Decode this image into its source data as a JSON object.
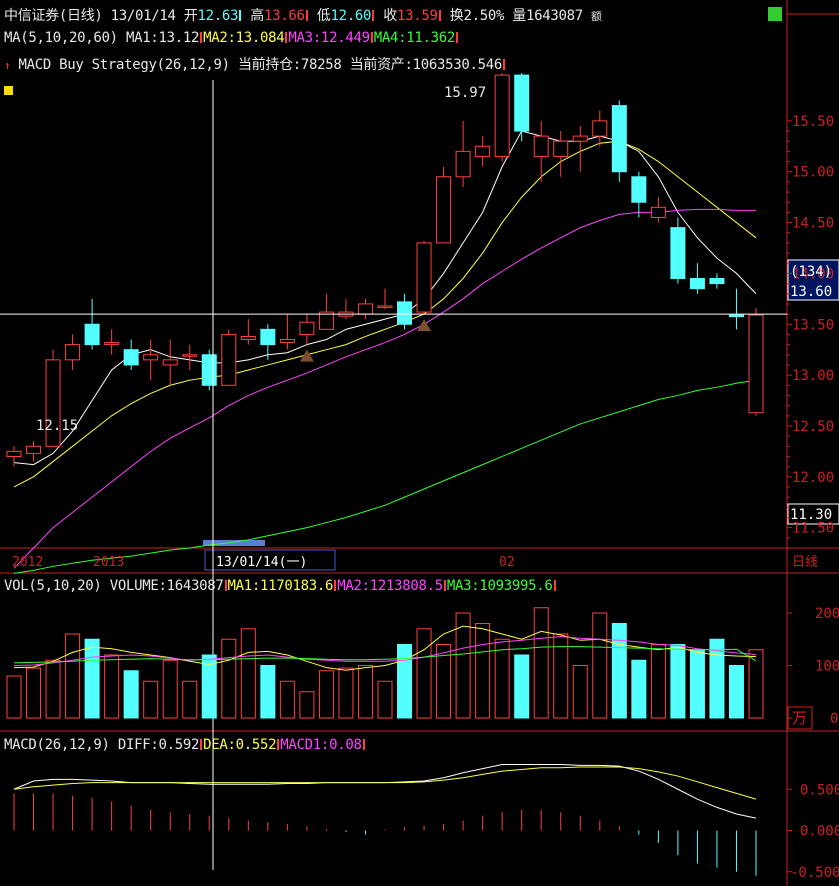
{
  "header": {
    "name": "中信证券",
    "period": "(日线)",
    "date": "13/01/14",
    "open_label": "开",
    "open": "12.63",
    "high_label": "高",
    "high": "13.66",
    "low_label": "低",
    "low": "12.60",
    "close_label": "收",
    "close": "13.59",
    "turnover_label": "换",
    "turnover": "2.50%",
    "volume_label": "量",
    "volume": "1643087",
    "extra": "额"
  },
  "ma_line": {
    "params": "MA(5,10,20,60)",
    "ma1": "MA1:13.12",
    "ma2": "MA2:13.084",
    "ma3": "MA3:12.449",
    "ma4": "MA4:11.362"
  },
  "strategy_line": {
    "name": "MACD Buy Strategy(26,12,9)",
    "position": "当前持仓:78258",
    "assets": "当前资产:1063530.546"
  },
  "vol_line": {
    "params": "VOL(5,10,20)",
    "volume": "VOLUME:1643087",
    "ma1": "MA1:1170183.6",
    "ma2": "MA2:1213808.5",
    "ma3": "MA3:1093995.6"
  },
  "macd_line": {
    "params": "MACD(26,12,9)",
    "diff": "DIFF:0.592",
    "dea": "DEA:0.552",
    "macd": "MACD1:0.08"
  },
  "labels": {
    "peak": "15.97",
    "trough": "12.15",
    "cursor_date": "13/01/14(一)",
    "year1": "2012",
    "year2": "2013",
    "month": "02",
    "period_btn": "日线",
    "unit": "万",
    "cursor_count": "(134)",
    "cursor_price": "13.60",
    "last_price": "11.30"
  },
  "chart_data": [
    {
      "type": "candlestick",
      "title": "中信证券(日线)",
      "ylim": [
        11.3,
        16.0
      ],
      "y_ticks": [
        "15.50",
        "15.00",
        "14.50",
        "14.00",
        "13.50",
        "13.00",
        "12.50",
        "12.00",
        "11.50"
      ],
      "candles": [
        [
          12.2,
          12.25,
          12.1,
          12.3
        ],
        [
          12.23,
          12.3,
          12.15,
          12.35
        ],
        [
          12.3,
          13.15,
          12.3,
          13.25
        ],
        [
          13.15,
          13.3,
          13.05,
          13.4
        ],
        [
          13.5,
          13.3,
          13.25,
          13.75
        ],
        [
          13.3,
          13.32,
          13.2,
          13.45
        ],
        [
          13.25,
          13.1,
          13.05,
          13.35
        ],
        [
          13.15,
          13.2,
          12.95,
          13.35
        ],
        [
          13.1,
          13.15,
          12.9,
          13.35
        ],
        [
          13.2,
          13.2,
          13.05,
          13.3
        ],
        [
          13.2,
          12.9,
          12.85,
          13.25
        ],
        [
          12.9,
          13.4,
          12.9,
          13.45
        ],
        [
          13.35,
          13.38,
          13.3,
          13.55
        ],
        [
          13.45,
          13.3,
          13.15,
          13.5
        ],
        [
          13.32,
          13.35,
          13.25,
          13.6
        ],
        [
          13.4,
          13.52,
          13.3,
          13.6
        ],
        [
          13.45,
          13.62,
          13.45,
          13.8
        ],
        [
          13.58,
          13.62,
          13.55,
          13.75
        ],
        [
          13.6,
          13.7,
          13.55,
          13.75
        ],
        [
          13.68,
          13.68,
          13.65,
          13.85
        ],
        [
          13.72,
          13.5,
          13.45,
          13.8
        ],
        [
          13.62,
          14.3,
          13.6,
          14.32
        ],
        [
          14.3,
          14.95,
          14.3,
          15.05
        ],
        [
          14.95,
          15.2,
          14.85,
          15.5
        ],
        [
          15.15,
          15.25,
          15.05,
          15.35
        ],
        [
          15.15,
          15.95,
          15.1,
          15.97
        ],
        [
          15.95,
          15.4,
          15.3,
          15.97
        ],
        [
          15.15,
          15.35,
          14.9,
          15.5
        ],
        [
          15.15,
          15.3,
          14.95,
          15.4
        ],
        [
          15.3,
          15.35,
          15.0,
          15.45
        ],
        [
          15.35,
          15.5,
          15.25,
          15.6
        ],
        [
          15.65,
          15.0,
          14.9,
          15.7
        ],
        [
          14.95,
          14.7,
          14.55,
          15.0
        ],
        [
          14.55,
          14.65,
          14.5,
          14.75
        ],
        [
          14.45,
          13.95,
          13.9,
          14.55
        ],
        [
          13.95,
          13.85,
          13.8,
          14.1
        ],
        [
          13.95,
          13.9,
          13.85,
          14.0
        ],
        [
          13.59,
          13.58,
          13.45,
          13.85
        ],
        [
          12.63,
          13.59,
          12.6,
          13.66
        ]
      ],
      "series": [
        {
          "name": "MA1",
          "values": [
            12.14,
            12.12,
            12.23,
            12.45,
            12.75,
            13.05,
            13.2,
            13.25,
            13.18,
            13.15,
            13.12,
            13.12,
            13.15,
            13.2,
            13.22,
            13.3,
            13.35,
            13.45,
            13.5,
            13.55,
            13.6,
            13.75,
            14.0,
            14.3,
            14.6,
            15.05,
            15.4,
            15.35,
            15.3,
            15.3,
            15.35,
            15.3,
            15.2,
            14.95,
            14.6,
            14.35,
            14.15,
            14.0,
            13.8
          ]
        },
        {
          "name": "MA2",
          "values": [
            11.9,
            12.0,
            12.15,
            12.3,
            12.45,
            12.6,
            12.72,
            12.82,
            12.9,
            12.95,
            12.98,
            13.0,
            13.05,
            13.1,
            13.15,
            13.2,
            13.25,
            13.3,
            13.38,
            13.45,
            13.52,
            13.6,
            13.75,
            13.95,
            14.2,
            14.5,
            14.75,
            14.95,
            15.1,
            15.2,
            15.28,
            15.3,
            15.22,
            15.1,
            14.95,
            14.8,
            14.65,
            14.5,
            14.35
          ]
        },
        {
          "name": "MA3",
          "values": [
            11.1,
            11.3,
            11.5,
            11.65,
            11.8,
            11.95,
            12.1,
            12.25,
            12.38,
            12.48,
            12.58,
            12.7,
            12.8,
            12.88,
            12.95,
            13.02,
            13.1,
            13.18,
            13.25,
            13.32,
            13.4,
            13.5,
            13.62,
            13.75,
            13.9,
            14.02,
            14.14,
            14.25,
            14.35,
            14.45,
            14.52,
            14.58,
            14.6,
            14.6,
            14.62,
            14.63,
            14.63,
            14.62,
            14.62
          ]
        },
        {
          "name": "MA4",
          "values": [
            11.05,
            11.08,
            11.12,
            11.15,
            11.18,
            11.2,
            11.22,
            11.25,
            11.28,
            11.3,
            11.33,
            11.35,
            11.38,
            11.42,
            11.46,
            11.5,
            11.55,
            11.6,
            11.66,
            11.72,
            11.8,
            11.88,
            11.96,
            12.04,
            12.12,
            12.2,
            12.28,
            12.36,
            12.44,
            12.52,
            12.58,
            12.64,
            12.7,
            12.76,
            12.8,
            12.85,
            12.88,
            12.92,
            12.95
          ]
        }
      ]
    },
    {
      "type": "bar",
      "title": "VOLUME",
      "ylim": [
        0,
        240
      ],
      "unit": "万",
      "y_ticks": [
        "200",
        "100",
        "0"
      ],
      "values": [
        80,
        95,
        110,
        160,
        150,
        120,
        90,
        70,
        110,
        70,
        120,
        150,
        170,
        100,
        70,
        50,
        90,
        95,
        100,
        70,
        140,
        170,
        140,
        200,
        180,
        150,
        120,
        210,
        160,
        100,
        200,
        180,
        110,
        140,
        140,
        130,
        150,
        100,
        130
      ],
      "series": [
        {
          "name": "MA1",
          "values": [
            96,
            97,
            108,
            125,
            135,
            132,
            125,
            120,
            115,
            108,
            102,
            110,
            125,
            127,
            120,
            108,
            96,
            91,
            96,
            100,
            110,
            130,
            160,
            175,
            170,
            160,
            150,
            165,
            158,
            148,
            150,
            140,
            135,
            130,
            135,
            125,
            120,
            118,
            117
          ]
        },
        {
          "name": "MA2",
          "values": [
            100,
            101,
            105,
            110,
            116,
            118,
            120,
            118,
            114,
            110,
            112,
            115,
            118,
            120,
            116,
            112,
            110,
            108,
            108,
            108,
            110,
            116,
            124,
            133,
            140,
            145,
            148,
            152,
            155,
            152,
            150,
            148,
            145,
            140,
            138,
            132,
            128,
            124,
            121
          ]
        },
        {
          "name": "MA3",
          "values": [
            105,
            106,
            107,
            108,
            110,
            111,
            112,
            113,
            112,
            111,
            111,
            112,
            113,
            114,
            114,
            113,
            112,
            111,
            111,
            112,
            113,
            116,
            119,
            122,
            126,
            130,
            132,
            135,
            136,
            136,
            135,
            134,
            133,
            132,
            131,
            130,
            130,
            131,
            109
          ]
        }
      ]
    },
    {
      "type": "bar",
      "title": "MACD",
      "ylim": [
        -0.6,
        1.0
      ],
      "y_ticks": [
        "0.500",
        "0.000",
        "-0.500"
      ],
      "values": [
        0.45,
        0.45,
        0.45,
        0.42,
        0.4,
        0.35,
        0.3,
        0.25,
        0.22,
        0.2,
        0.18,
        0.15,
        0.12,
        0.1,
        0.08,
        0.05,
        0.02,
        -0.02,
        -0.05,
        0.01,
        0.04,
        0.06,
        0.08,
        0.12,
        0.18,
        0.22,
        0.25,
        0.25,
        0.22,
        0.18,
        0.12,
        0.05,
        -0.05,
        -0.15,
        -0.3,
        -0.4,
        -0.45,
        -0.5,
        -0.55
      ],
      "series": [
        {
          "name": "DIFF",
          "values": [
            0.5,
            0.6,
            0.62,
            0.62,
            0.61,
            0.6,
            0.58,
            0.58,
            0.58,
            0.57,
            0.56,
            0.56,
            0.56,
            0.56,
            0.57,
            0.57,
            0.58,
            0.58,
            0.58,
            0.58,
            0.59,
            0.6,
            0.64,
            0.7,
            0.75,
            0.8,
            0.8,
            0.8,
            0.8,
            0.79,
            0.79,
            0.78,
            0.72,
            0.62,
            0.5,
            0.38,
            0.28,
            0.2,
            0.15
          ]
        },
        {
          "name": "DEA",
          "values": [
            0.5,
            0.53,
            0.55,
            0.57,
            0.58,
            0.58,
            0.58,
            0.58,
            0.58,
            0.58,
            0.58,
            0.58,
            0.58,
            0.58,
            0.58,
            0.58,
            0.58,
            0.58,
            0.58,
            0.58,
            0.58,
            0.59,
            0.61,
            0.64,
            0.68,
            0.72,
            0.74,
            0.76,
            0.76,
            0.77,
            0.77,
            0.77,
            0.75,
            0.71,
            0.66,
            0.59,
            0.52,
            0.45,
            0.38
          ]
        }
      ]
    }
  ]
}
